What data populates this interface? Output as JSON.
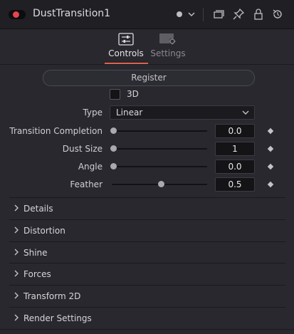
{
  "header": {
    "node_title": "DustTransition1",
    "icons": [
      "toggle-switch",
      "color-dot",
      "chevron-down-icon",
      "versions-icon",
      "pin-icon",
      "lock-icon",
      "reset-icon"
    ],
    "toggle_color": "#e94350"
  },
  "tabs": [
    {
      "label": "Controls",
      "icon": "sliders-icon",
      "active": true
    },
    {
      "label": "Settings",
      "icon": "settings-icon",
      "active": false
    }
  ],
  "accent_color": "#e0614c",
  "controls": {
    "register_label": "Register",
    "checkbox_3d": {
      "label": "3D",
      "checked": false
    },
    "type": {
      "label": "Type",
      "value": "Linear"
    },
    "sliders": [
      {
        "label": "Transition Completion",
        "value": "0.0",
        "position": 0.0
      },
      {
        "label": "Dust Size",
        "value": "1",
        "position": 0.0
      },
      {
        "label": "Angle",
        "value": "0.0",
        "position": 0.0
      },
      {
        "label": "Feather",
        "value": "0.5",
        "position": 0.5
      }
    ]
  },
  "sections": [
    {
      "label": "Details"
    },
    {
      "label": "Distortion"
    },
    {
      "label": "Shine"
    },
    {
      "label": "Forces"
    },
    {
      "label": "Transform 2D"
    },
    {
      "label": "Render Settings"
    }
  ]
}
